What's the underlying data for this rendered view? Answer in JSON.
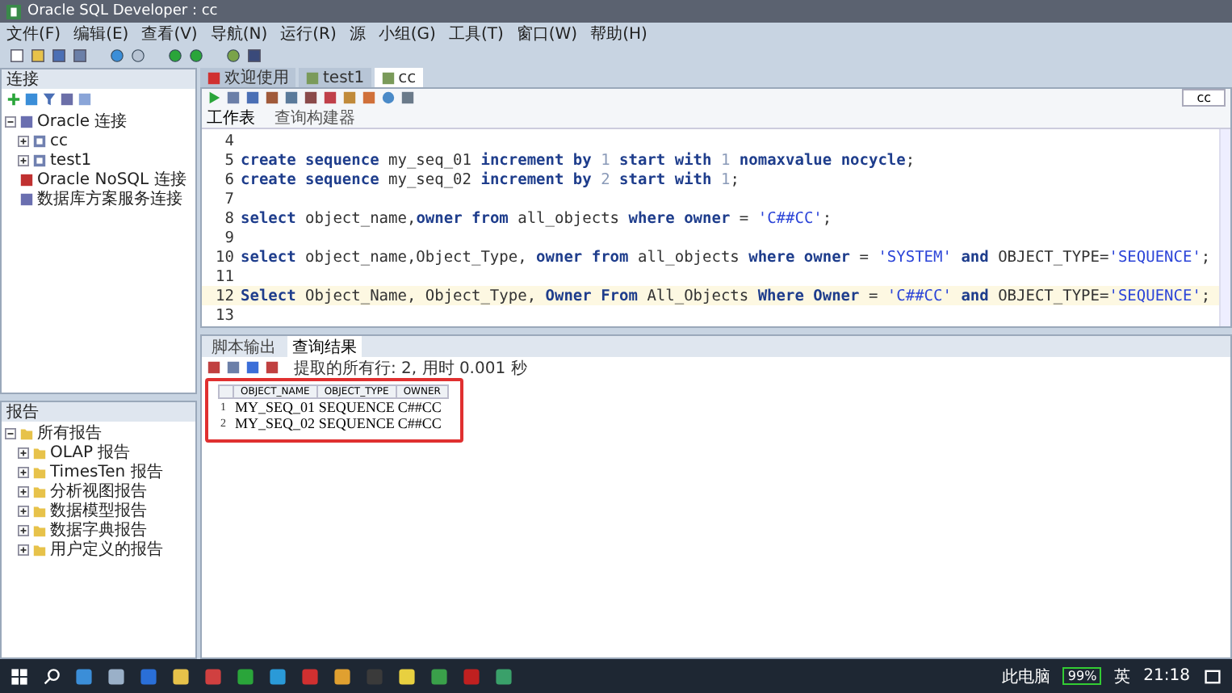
{
  "window": {
    "title": "Oracle SQL Developer : cc"
  },
  "menu": [
    "文件(F)",
    "编辑(E)",
    "查看(V)",
    "导航(N)",
    "运行(R)",
    "源",
    "小组(G)",
    "工具(T)",
    "窗口(W)",
    "帮助(H)"
  ],
  "connections": {
    "title": "连接",
    "tree": [
      {
        "label": "Oracle 连接",
        "expanded": true,
        "children": [
          {
            "label": "cc",
            "expanded": false
          },
          {
            "label": "test1",
            "expanded": false
          }
        ]
      },
      {
        "label": "Oracle NoSQL 连接"
      },
      {
        "label": "数据库方案服务连接"
      }
    ]
  },
  "reports": {
    "title": "报告",
    "tree": [
      {
        "label": "所有报告",
        "expanded": true,
        "children": [
          {
            "label": "OLAP 报告",
            "expanded": false
          },
          {
            "label": "TimesTen 报告",
            "expanded": false
          },
          {
            "label": "分析视图报告",
            "expanded": false
          },
          {
            "label": "数据模型报告",
            "expanded": false
          },
          {
            "label": "数据字典报告",
            "expanded": false
          },
          {
            "label": "用户定义的报告",
            "expanded": false
          }
        ]
      }
    ]
  },
  "editor_tabs": [
    {
      "label": "欢迎使用",
      "selected": false
    },
    {
      "label": "test1",
      "selected": false
    },
    {
      "label": "cc",
      "selected": true
    }
  ],
  "connection_picker": "cc",
  "sub_tabs": [
    {
      "label": "工作表",
      "selected": true
    },
    {
      "label": "查询构建器",
      "selected": false
    }
  ],
  "code": [
    {
      "number": "4",
      "current": false
    },
    {
      "number": "5",
      "current": false,
      "tokens": [
        {
          "text": "create sequence",
          "kind": "keyword"
        },
        {
          "text": " my_seq_01 ",
          "kind": "plain"
        },
        {
          "text": "increment by",
          "kind": "keyword"
        },
        {
          "text": " 1 ",
          "kind": "number"
        },
        {
          "text": "start with",
          "kind": "keyword"
        },
        {
          "text": " 1 ",
          "kind": "number"
        },
        {
          "text": "nomaxvalue nocycle",
          "kind": "keyword"
        },
        {
          "text": ";",
          "kind": "plain"
        }
      ]
    },
    {
      "number": "6",
      "current": false,
      "tokens": [
        {
          "text": "create sequence",
          "kind": "keyword"
        },
        {
          "text": " my_seq_02 ",
          "kind": "plain"
        },
        {
          "text": "increment by",
          "kind": "keyword"
        },
        {
          "text": " 2 ",
          "kind": "number"
        },
        {
          "text": "start with",
          "kind": "keyword"
        },
        {
          "text": " 1",
          "kind": "number"
        },
        {
          "text": ";",
          "kind": "plain"
        }
      ]
    },
    {
      "number": "7",
      "current": false
    },
    {
      "number": "8",
      "current": false,
      "tokens": [
        {
          "text": "select",
          "kind": "keyword"
        },
        {
          "text": " object_name,",
          "kind": "plain"
        },
        {
          "text": "owner from",
          "kind": "keyword"
        },
        {
          "text": " all_objects ",
          "kind": "plain"
        },
        {
          "text": "where owner",
          "kind": "keyword"
        },
        {
          "text": " = ",
          "kind": "plain"
        },
        {
          "text": "'C##CC'",
          "kind": "string"
        },
        {
          "text": ";",
          "kind": "plain"
        }
      ]
    },
    {
      "number": "9",
      "current": false
    },
    {
      "number": "10",
      "current": false,
      "tokens": [
        {
          "text": "select",
          "kind": "keyword"
        },
        {
          "text": " object_name,Object_Type, ",
          "kind": "plain"
        },
        {
          "text": "owner from",
          "kind": "keyword"
        },
        {
          "text": " all_objects ",
          "kind": "plain"
        },
        {
          "text": "where owner",
          "kind": "keyword"
        },
        {
          "text": " = ",
          "kind": "plain"
        },
        {
          "text": "'SYSTEM'",
          "kind": "string"
        },
        {
          "text": " and ",
          "kind": "keyword"
        },
        {
          "text": "OBJECT_TYPE=",
          "kind": "plain"
        },
        {
          "text": "'SEQUENCE'",
          "kind": "string"
        },
        {
          "text": ";",
          "kind": "plain"
        }
      ]
    },
    {
      "number": "11",
      "current": false
    },
    {
      "number": "12",
      "current": true,
      "tokens": [
        {
          "text": "Select",
          "kind": "keyword"
        },
        {
          "text": " Object_Name, Object_Type, ",
          "kind": "plain"
        },
        {
          "text": "Owner From",
          "kind": "keyword"
        },
        {
          "text": " All_Objects ",
          "kind": "plain"
        },
        {
          "text": "Where Owner",
          "kind": "keyword"
        },
        {
          "text": " = ",
          "kind": "plain"
        },
        {
          "text": "'C##CC'",
          "kind": "string"
        },
        {
          "text": " and ",
          "kind": "keyword"
        },
        {
          "text": "OBJECT_TYPE=",
          "kind": "plain"
        },
        {
          "text": "'SEQUENCE'",
          "kind": "string"
        },
        {
          "text": ";",
          "kind": "plain"
        }
      ]
    },
    {
      "number": "13",
      "current": false
    }
  ],
  "results": {
    "tabs": [
      {
        "label": "脚本输出",
        "selected": false
      },
      {
        "label": "查询结果",
        "selected": true
      }
    ],
    "status": "提取的所有行: 2, 用时 0.001 秒",
    "columns": [
      "",
      "OBJECT_NAME",
      "OBJECT_TYPE",
      "OWNER"
    ],
    "rows": [
      [
        "1",
        "MY_SEQ_01",
        "SEQUENCE",
        "C##CC"
      ],
      [
        "2",
        "MY_SEQ_02",
        "SEQUENCE",
        "C##CC"
      ]
    ]
  },
  "taskbar": {
    "tray": [
      "此电脑",
      "99%",
      "英",
      "21:18"
    ]
  }
}
